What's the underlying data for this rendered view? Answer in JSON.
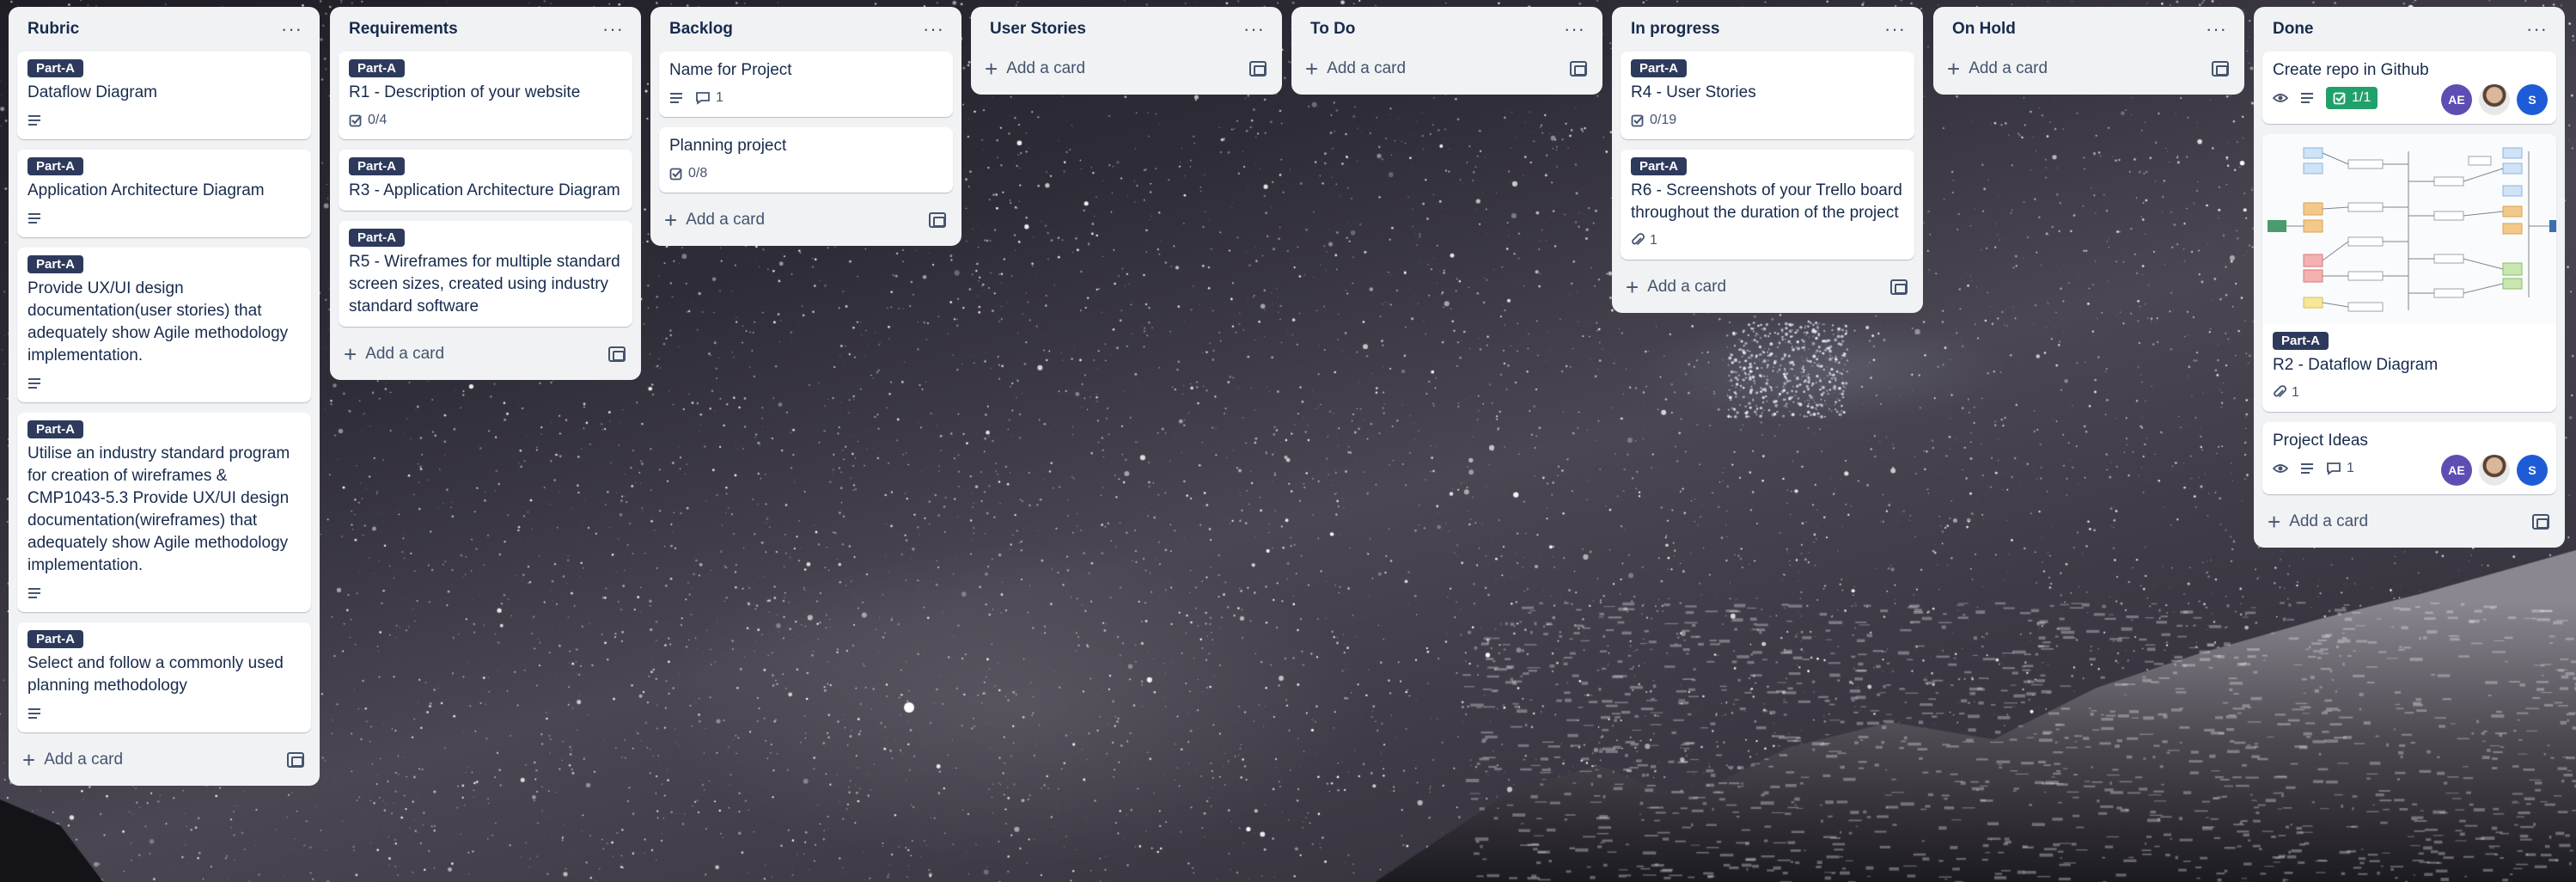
{
  "board": {
    "lists": [
      {
        "title": "Rubric",
        "add_card_label": "Add a card",
        "cards": [
          {
            "label": "Part-A",
            "title": "Dataflow Diagram"
          },
          {
            "label": "Part-A",
            "title": "Application Architecture Diagram"
          },
          {
            "label": "Part-A",
            "title": "Provide UX/UI design documentation(user stories) that adequately show Agile methodology implementation."
          },
          {
            "label": "Part-A",
            "title": "Utilise an industry standard program for creation of wireframes & CMP1043-5.3 Provide UX/UI design documentation(wireframes) that adequately show Agile methodology implementation."
          },
          {
            "label": "Part-A",
            "title": "Select and follow a commonly used planning methodology"
          }
        ]
      },
      {
        "title": "Requirements",
        "add_card_label": "Add a card",
        "cards": [
          {
            "label": "Part-A",
            "title": "R1 - Description of your website",
            "checklist": "0/4"
          },
          {
            "label": "Part-A",
            "title": "R3 - Application Architecture Diagram"
          },
          {
            "label": "Part-A",
            "title": "R5 - Wireframes for multiple standard screen sizes, created using industry standard software"
          }
        ]
      },
      {
        "title": "Backlog",
        "add_card_label": "Add a card",
        "cards": [
          {
            "title": "Name for Project",
            "comments": "1"
          },
          {
            "title": "Planning project",
            "checklist": "0/8"
          }
        ]
      },
      {
        "title": "User Stories",
        "add_card_label": "Add a card",
        "cards": []
      },
      {
        "title": "To Do",
        "add_card_label": "Add a card",
        "cards": []
      },
      {
        "title": "In progress",
        "add_card_label": "Add a card",
        "cards": [
          {
            "label": "Part-A",
            "title": "R4 - User Stories",
            "checklist": "0/19"
          },
          {
            "label": "Part-A",
            "title": "R6 - Screenshots of your Trello board throughout the duration of the project",
            "attachments": "1"
          }
        ]
      },
      {
        "title": "On Hold",
        "add_card_label": "Add a card",
        "cards": []
      },
      {
        "title": "Done",
        "add_card_label": "Add a card",
        "cards": [
          {
            "title": "Create repo in Github",
            "checklist": "1/1",
            "members": [
              "AE",
              "",
              "S"
            ]
          },
          {
            "label": "Part-A",
            "title": "R2 - Dataflow Diagram",
            "attachments": "1"
          },
          {
            "title": "Project Ideas",
            "comments": "1",
            "members": [
              "AE",
              "",
              "S"
            ]
          }
        ]
      }
    ]
  },
  "colors": {
    "label_dark_blue": "#2e3a5c",
    "checklist_complete": "#22a06b",
    "list_bg": "#f1f2f4",
    "avatar_ae": "#5e4db2",
    "avatar_s": "#1d5cd6"
  },
  "icons": [
    "ellipsis-icon",
    "description-icon",
    "comment-icon",
    "checklist-icon",
    "attachment-icon",
    "watch-icon",
    "plus-icon",
    "template-icon"
  ]
}
